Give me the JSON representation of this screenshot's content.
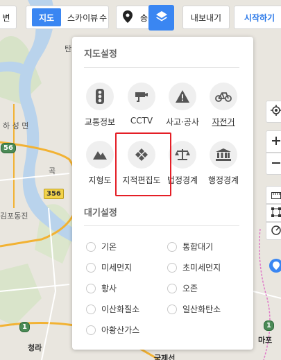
{
  "toolbar": {
    "edge_button_label": "변",
    "map_type_tabs": [
      "지도",
      "스카이뷰"
    ],
    "overflow_text": "수",
    "pin_label": "송",
    "export_label": "내보내기",
    "start_label": "시작하기"
  },
  "map": {
    "labels": [
      "탄",
      "하 성 면",
      "곡",
      "김포동진",
      "청라",
      "국제선",
      "마포"
    ],
    "road_numbers": [
      "56",
      "356",
      "1",
      "1"
    ],
    "colors": {
      "land": "#e9e6df",
      "river": "#b9d3ec",
      "highway": "#f2b233",
      "road": "#ffffff"
    }
  },
  "panel": {
    "map_settings": {
      "title": "지도설정",
      "tiles": [
        {
          "label": "교통정보",
          "icon": "traffic-light-icon"
        },
        {
          "label": "CCTV",
          "icon": "cctv-camera-icon"
        },
        {
          "label": "사고·공사",
          "icon": "warning-icon"
        },
        {
          "label": "자전거",
          "icon": "bicycle-icon"
        },
        {
          "label": "지형도",
          "icon": "mountain-icon"
        },
        {
          "label": "지적편집도",
          "icon": "cadastral-tiles-icon"
        },
        {
          "label": "법정경계",
          "icon": "scale-icon"
        },
        {
          "label": "행정경계",
          "icon": "government-building-icon"
        }
      ]
    },
    "air_settings": {
      "title": "대기설정",
      "options": [
        "기온",
        "통합대기",
        "미세먼지",
        "초미세먼지",
        "황사",
        "오존",
        "이산화질소",
        "일산화탄소",
        "아황산가스"
      ]
    }
  },
  "colors": {
    "accent": "#3a86f2",
    "highlight": "#e41e26"
  }
}
